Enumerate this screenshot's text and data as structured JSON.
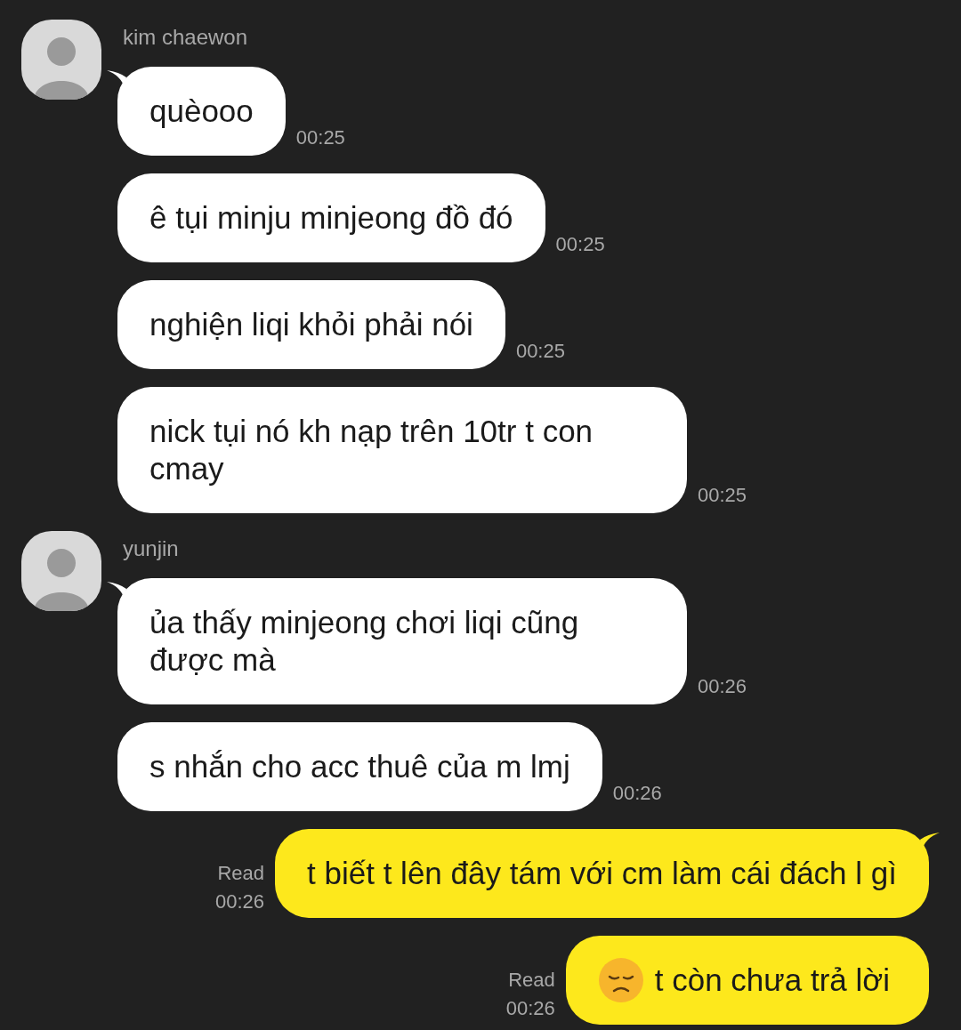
{
  "groups": [
    {
      "kind": "incoming",
      "sender": "kim chaewon",
      "messages": [
        {
          "kind": "text",
          "text": "quèooo",
          "time": "00:25"
        },
        {
          "kind": "text",
          "text": "ê tụi minju minjeong đồ đó",
          "time": "00:25"
        },
        {
          "kind": "text",
          "text": "nghiện liqi khỏi phải nói",
          "time": "00:25"
        },
        {
          "kind": "text",
          "text": "nick tụi nó kh nạp trên 10tr t con cmay",
          "time": "00:25"
        }
      ]
    },
    {
      "kind": "incoming",
      "sender": "yunjin",
      "messages": [
        {
          "kind": "text",
          "text": "ủa thấy minjeong chơi liqi cũng được mà",
          "time": "00:26"
        },
        {
          "kind": "text",
          "text": "s nhắn cho acc thuê của m lmj",
          "time": "00:26"
        }
      ]
    },
    {
      "kind": "outgoing",
      "messages": [
        {
          "kind": "text",
          "read": "Read",
          "text": "t biết t lên đây tám với cm làm cái đách l gì",
          "time": "00:26"
        },
        {
          "kind": "with-emoji",
          "read": "Read",
          "text": "t còn chưa trả lời",
          "time": "00:26"
        }
      ]
    }
  ]
}
